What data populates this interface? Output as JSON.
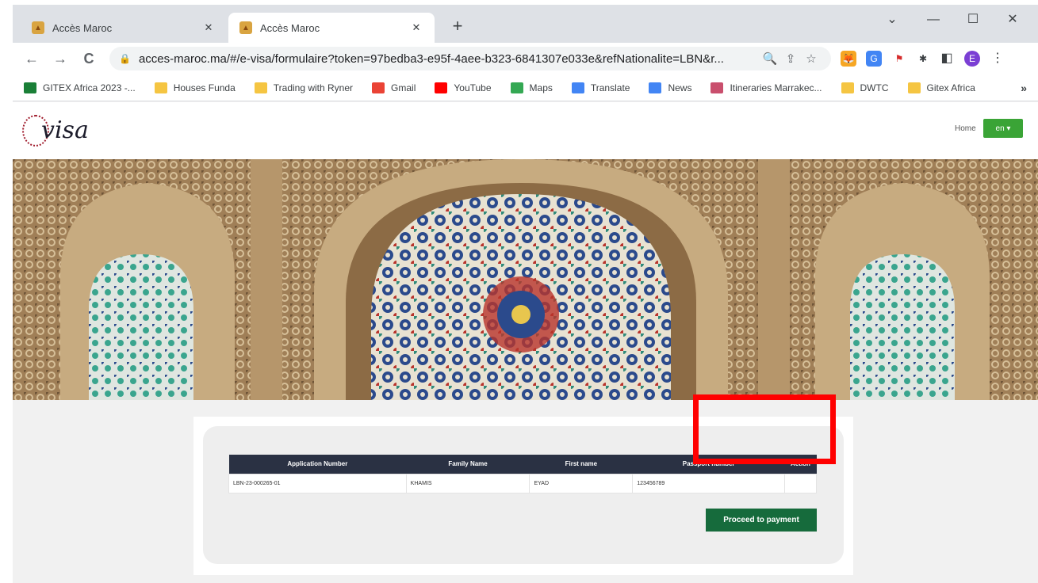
{
  "browser": {
    "tabs": [
      {
        "title": "Accès Maroc",
        "close": "✕"
      },
      {
        "title": "Accès Maroc",
        "close": "✕"
      }
    ],
    "new_tab": "+",
    "window_controls": {
      "dropdown": "⌄",
      "minimize": "—",
      "maximize": "☐",
      "close": "✕"
    },
    "nav": {
      "back": "←",
      "forward": "→",
      "reload": "C"
    },
    "url": "acces-maroc.ma/#/e-visa/formulaire?token=97bedba3-e95f-4aee-b323-6841307e033e&refNationalite=LBN&r...",
    "profile_initial": "E",
    "menu": "⋮",
    "bookmarks": [
      {
        "label": "GITEX Africa 2023 -...",
        "color": "#1a7f37"
      },
      {
        "label": "Houses Funda",
        "color": "#f5c542"
      },
      {
        "label": "Trading with Ryner",
        "color": "#f5c542"
      },
      {
        "label": "Gmail",
        "color": "#ea4335"
      },
      {
        "label": "YouTube",
        "color": "#ff0000"
      },
      {
        "label": "Maps",
        "color": "#34a853"
      },
      {
        "label": "Translate",
        "color": "#4285f4"
      },
      {
        "label": "News",
        "color": "#4285f4"
      },
      {
        "label": "Itineraries Marrakec...",
        "color": "#c94f6d"
      },
      {
        "label": "DWTC",
        "color": "#f5c542"
      },
      {
        "label": "Gitex Africa",
        "color": "#f5c542"
      }
    ],
    "bookmarks_more": "»"
  },
  "site": {
    "logo_text": "visa",
    "home_link": "Home",
    "language": "en ▾"
  },
  "table": {
    "headers": [
      "Application Number",
      "Family Name",
      "First name",
      "Passport number",
      "Action"
    ],
    "rows": [
      [
        "LBN-23-000265-01",
        "KHAMIS",
        "EYAD",
        "123456789",
        ""
      ]
    ]
  },
  "pay_button": "Proceed to payment",
  "colors": {
    "table_header": "#2a3143",
    "pay_button": "#166b3c",
    "highlight": "#ff0000",
    "language_button": "#3aa436"
  }
}
